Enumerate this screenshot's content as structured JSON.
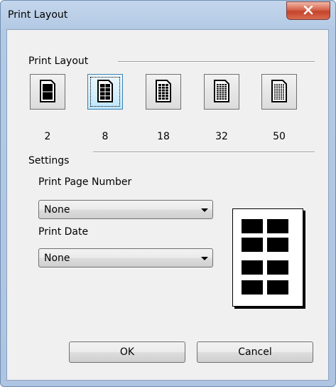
{
  "window": {
    "title": "Print Layout"
  },
  "print_layout": {
    "label": "Print Layout",
    "options": [
      {
        "value": "2",
        "icon": "two-up-page-icon",
        "selected": false
      },
      {
        "value": "8",
        "icon": "eight-up-page-icon",
        "selected": true
      },
      {
        "value": "18",
        "icon": "eighteen-up-page-icon",
        "selected": false
      },
      {
        "value": "32",
        "icon": "thirty-two-up-page-icon",
        "selected": false
      },
      {
        "value": "50",
        "icon": "fifty-up-page-icon",
        "selected": false
      }
    ]
  },
  "settings": {
    "label": "Settings",
    "page_number": {
      "label": "Print Page Number",
      "value": "None"
    },
    "date": {
      "label": "Print Date",
      "value": "None"
    }
  },
  "buttons": {
    "ok": "OK",
    "cancel": "Cancel"
  },
  "colors": {
    "selected_accent": "#3c7fb1",
    "close_button": "#c4452c"
  }
}
